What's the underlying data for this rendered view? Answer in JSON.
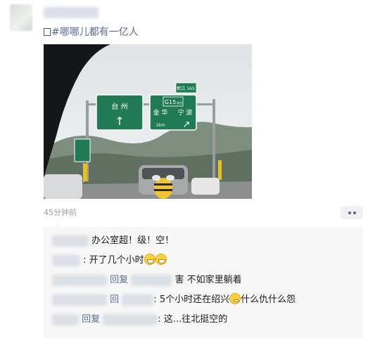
{
  "post": {
    "text": "#哪哪儿都有一亿人",
    "time": "45分钟前",
    "photo_signs": {
      "left": {
        "city": "台 州",
        "arrow": "↑"
      },
      "right": {
        "route": "G15",
        "route_suffix": "甬台",
        "city_a": "金 华",
        "city_b": "宁 波",
        "distance": "1km",
        "arrow": "↗"
      },
      "exit_badge": "新江 165"
    }
  },
  "comments": [
    {
      "name": "",
      "sep": "",
      "text": "办公室超！级！空！"
    },
    {
      "name": "",
      "sep": ": ",
      "text": "开了几个小时",
      "emoji": [
        "grin",
        "grin"
      ]
    },
    {
      "name": "回复",
      "sep": "",
      "text": "害 不如家里躺着"
    },
    {
      "name": "回",
      "sep": ": ",
      "text": "5个小时还在绍兴",
      "emoji_after": "smirk",
      "text2": "什么仇什么怨"
    },
    {
      "name": "回复",
      "sep": ": ",
      "text": "这...往北挺空的"
    }
  ],
  "colors": {
    "link": "#576b95",
    "sign_green": "#1f7a55",
    "comment_bg": "#f7f7f7"
  }
}
